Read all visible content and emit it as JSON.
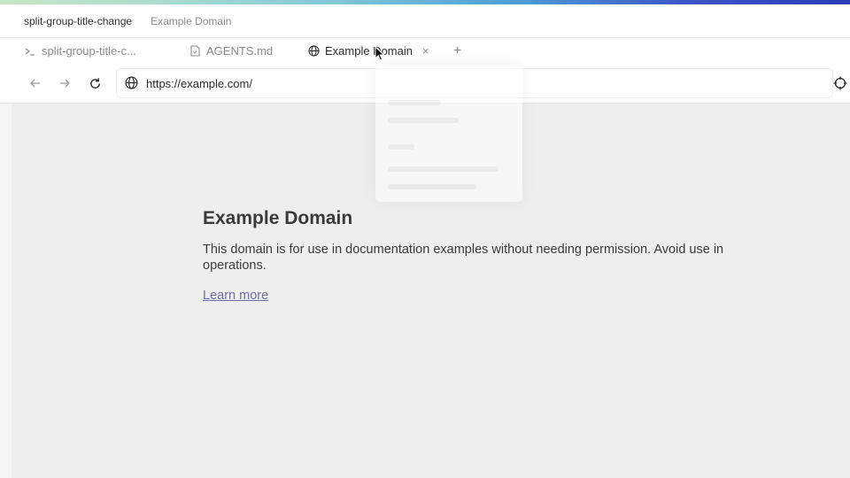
{
  "title_bar": {
    "primary": "split-group-title-change",
    "secondary": "Example Domain"
  },
  "tabs": [
    {
      "label": "split-group-title-c...",
      "icon": "terminal-icon",
      "active": false
    },
    {
      "label": "AGENTS.md",
      "icon": "file-icon",
      "active": false
    },
    {
      "label": "Example Domain",
      "icon": "globe-icon",
      "active": true
    }
  ],
  "tab_controls": {
    "close": "×",
    "new": "+"
  },
  "nav": {
    "url": "https://example.com/"
  },
  "page": {
    "heading": "Example Domain",
    "body": "This domain is for use in documentation examples without needing permission. Avoid use in operations.",
    "link": "Learn more"
  },
  "colors": {
    "accent_gradient_start": "#c9e6c5",
    "accent_gradient_end": "#2b3bb8",
    "link": "#6d6f9e"
  }
}
